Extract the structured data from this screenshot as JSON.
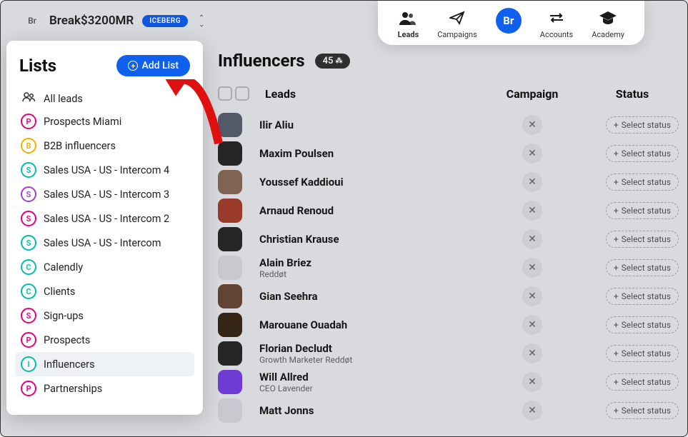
{
  "workspace": {
    "badge": "Br",
    "name": "Break$3200MR",
    "tag": "ICEBERG"
  },
  "nav": {
    "leads": "Leads",
    "campaigns": "Campaigns",
    "brand": "Br",
    "accounts": "Accounts",
    "academy": "Academy"
  },
  "sidebar": {
    "title": "Lists",
    "add_label": "Add List",
    "all_leads": "All leads",
    "items": [
      {
        "letter": "P",
        "color": "#e6007a",
        "label": "Prospects Miami"
      },
      {
        "letter": "B",
        "color": "#f0b000",
        "label": "B2B influencers"
      },
      {
        "letter": "S",
        "color": "#00bfa5",
        "label": "Sales USA - US - Intercom 4"
      },
      {
        "letter": "S",
        "color": "#9b3fd6",
        "label": "Sales USA - US - Intercom 3"
      },
      {
        "letter": "S",
        "color": "#e6007a",
        "label": "Sales USA - US - Intercom 2"
      },
      {
        "letter": "S",
        "color": "#00bfa5",
        "label": "Sales USA - US - Intercom"
      },
      {
        "letter": "C",
        "color": "#00bfa5",
        "label": "Calendly"
      },
      {
        "letter": "C",
        "color": "#00bfa5",
        "label": "Clients"
      },
      {
        "letter": "S",
        "color": "#e6007a",
        "label": "Sign-ups"
      },
      {
        "letter": "P",
        "color": "#e6007a",
        "label": "Prospects"
      },
      {
        "letter": "I",
        "color": "#00bfa5",
        "label": "Influencers"
      },
      {
        "letter": "P",
        "color": "#e6007a",
        "label": "Partnerships"
      }
    ]
  },
  "main": {
    "title": "Influencers",
    "count": "45",
    "headers": {
      "leads": "Leads",
      "campaign": "Campaign",
      "status": "Status"
    },
    "status_label": "Select status",
    "leads": [
      {
        "name": "Ilir Aliu",
        "sub": "",
        "av": "#5b6270"
      },
      {
        "name": "Maxim Poulsen",
        "sub": "",
        "av": "#2a2a2a"
      },
      {
        "name": "Youssef Kaddioui",
        "sub": "",
        "av": "#8a6d5b"
      },
      {
        "name": "Arnaud Renoud",
        "sub": "",
        "av": "#a84030"
      },
      {
        "name": "Christian Krause",
        "sub": "",
        "av": "#2a2a2a"
      },
      {
        "name": "Alain Briez",
        "sub": "Reddøt",
        "av": "#d8dbe0"
      },
      {
        "name": "Gian Seehra",
        "sub": "",
        "av": "#6b4a3a"
      },
      {
        "name": "Marouane Ouadah",
        "sub": "",
        "av": "#3a2a1a"
      },
      {
        "name": "Florian Decludt",
        "sub": "Growth Marketer Reddøt",
        "av": "#2a2a2a"
      },
      {
        "name": "Will Allred",
        "sub": "CEO Lavender",
        "av": "#7a3fe6"
      },
      {
        "name": "Matt Jonns",
        "sub": "",
        "av": "#d8dbe0"
      }
    ]
  }
}
